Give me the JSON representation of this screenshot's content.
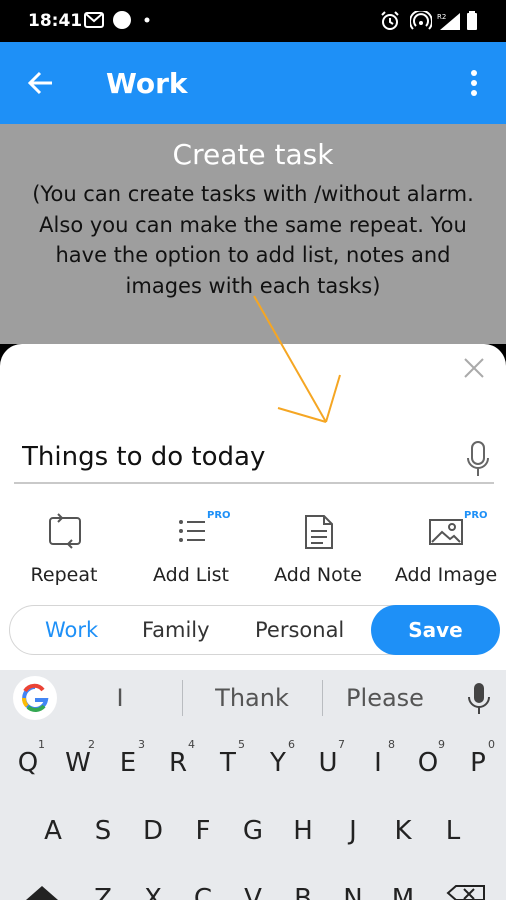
{
  "status_bar": {
    "time": "18:41"
  },
  "app_bar": {
    "title": "Work"
  },
  "tip": {
    "title": "Create task",
    "text": "(You can create tasks with /without alarm. Also you can make the same repeat. You have the option to add list, notes and images with each tasks)"
  },
  "task": {
    "value": "Things to do today"
  },
  "actions": [
    {
      "label": "Repeat",
      "icon": "repeat-icon"
    },
    {
      "label": "Add List",
      "icon": "list-icon",
      "badge": "PRO"
    },
    {
      "label": "Add Note",
      "icon": "note-icon"
    },
    {
      "label": "Add Image",
      "icon": "image-icon",
      "badge": "PRO"
    }
  ],
  "categories": [
    "Work",
    "Family",
    "Personal"
  ],
  "selected_category": "Work",
  "save_label": "Save",
  "keyboard": {
    "suggestions": [
      "I",
      "Thank",
      "Please"
    ],
    "row1": [
      "Q",
      "W",
      "E",
      "R",
      "T",
      "Y",
      "U",
      "I",
      "O",
      "P"
    ],
    "row1_numbers": [
      "1",
      "2",
      "3",
      "4",
      "5",
      "6",
      "7",
      "8",
      "9",
      "0"
    ],
    "row2": [
      "A",
      "S",
      "D",
      "F",
      "G",
      "H",
      "J",
      "K",
      "L"
    ],
    "row3": [
      "Z",
      "X",
      "C",
      "V",
      "B",
      "N",
      "M"
    ]
  },
  "colors": {
    "accent": "#1e90f7",
    "overlay": "#9e9e9e",
    "arrow": "#f5a623"
  }
}
